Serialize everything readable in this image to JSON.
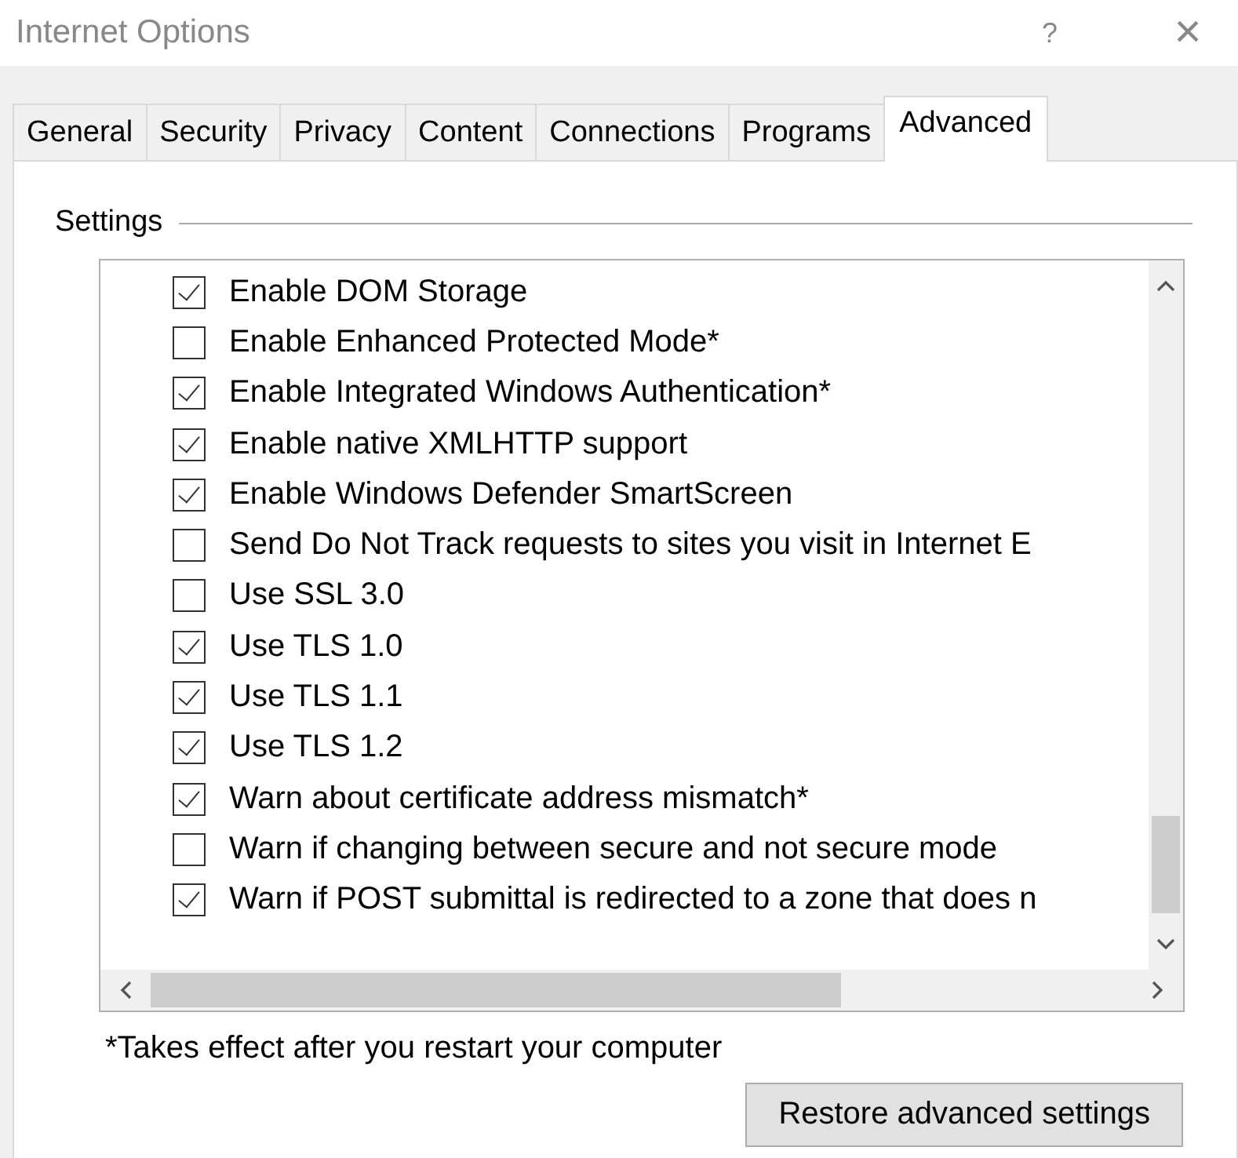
{
  "window": {
    "title": "Internet Options",
    "help": "?",
    "close": "×"
  },
  "tabs": [
    {
      "label": "General",
      "selected": false
    },
    {
      "label": "Security",
      "selected": false
    },
    {
      "label": "Privacy",
      "selected": false
    },
    {
      "label": "Content",
      "selected": false
    },
    {
      "label": "Connections",
      "selected": false
    },
    {
      "label": "Programs",
      "selected": false
    },
    {
      "label": "Advanced",
      "selected": true
    }
  ],
  "settings": {
    "title": "Settings",
    "items": [
      {
        "label": "Enable DOM Storage",
        "checked": true
      },
      {
        "label": "Enable Enhanced Protected Mode*",
        "checked": false
      },
      {
        "label": "Enable Integrated Windows Authentication*",
        "checked": true
      },
      {
        "label": "Enable native XMLHTTP support",
        "checked": true
      },
      {
        "label": "Enable Windows Defender SmartScreen",
        "checked": true
      },
      {
        "label": "Send Do Not Track requests to sites you visit in Internet E",
        "checked": false
      },
      {
        "label": "Use SSL 3.0",
        "checked": false
      },
      {
        "label": "Use TLS 1.0",
        "checked": true
      },
      {
        "label": "Use TLS 1.1",
        "checked": true
      },
      {
        "label": "Use TLS 1.2",
        "checked": true
      },
      {
        "label": "Warn about certificate address mismatch*",
        "checked": true
      },
      {
        "label": "Warn if changing between secure and not secure mode",
        "checked": false
      },
      {
        "label": "Warn if POST submittal is redirected to a zone that does n",
        "checked": true
      }
    ]
  },
  "footnote": "*Takes effect after you restart your computer",
  "buttons": [
    "Restore advanced settings"
  ]
}
